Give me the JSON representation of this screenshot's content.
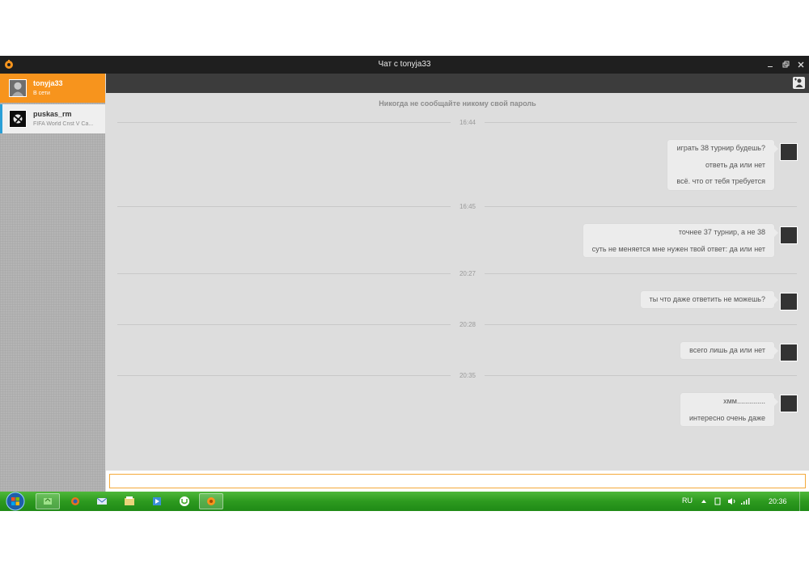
{
  "window": {
    "title": "Чат с tonyja33"
  },
  "contacts": [
    {
      "name": "tonyja33",
      "status": "В сети",
      "active": true
    },
    {
      "name": "puskas_rm",
      "status": "FIFA World Cnst V Ca...",
      "active": false
    }
  ],
  "chat": {
    "notice": "Никогда не сообщайте никому свой пароль",
    "timestamps": [
      "16:44",
      "16:45",
      "20:27",
      "20:28",
      "20:35"
    ],
    "groups": [
      {
        "messages": [
          "играть 38 турнир будешь?",
          "ответь да или нет",
          "всё. что от тебя требуется"
        ]
      },
      {
        "messages": [
          "точнее 37 турнир, а не 38",
          "суть не меняется мне нужен твой ответ: да или нет"
        ]
      },
      {
        "messages": [
          "ты что даже ответить не можешь?"
        ]
      },
      {
        "messages": [
          "всего лишь да или нет"
        ]
      },
      {
        "messages": [
          "хмм..............",
          "интересно очень даже"
        ]
      }
    ]
  },
  "input": {
    "value": ""
  },
  "taskbar": {
    "language": "RU",
    "clock": "20:36"
  },
  "colors": {
    "accent": "#f7941d",
    "titlebar": "#1f1f1f",
    "toolbar": "#3c3c3c",
    "taskbar": "#2d9a1f"
  }
}
